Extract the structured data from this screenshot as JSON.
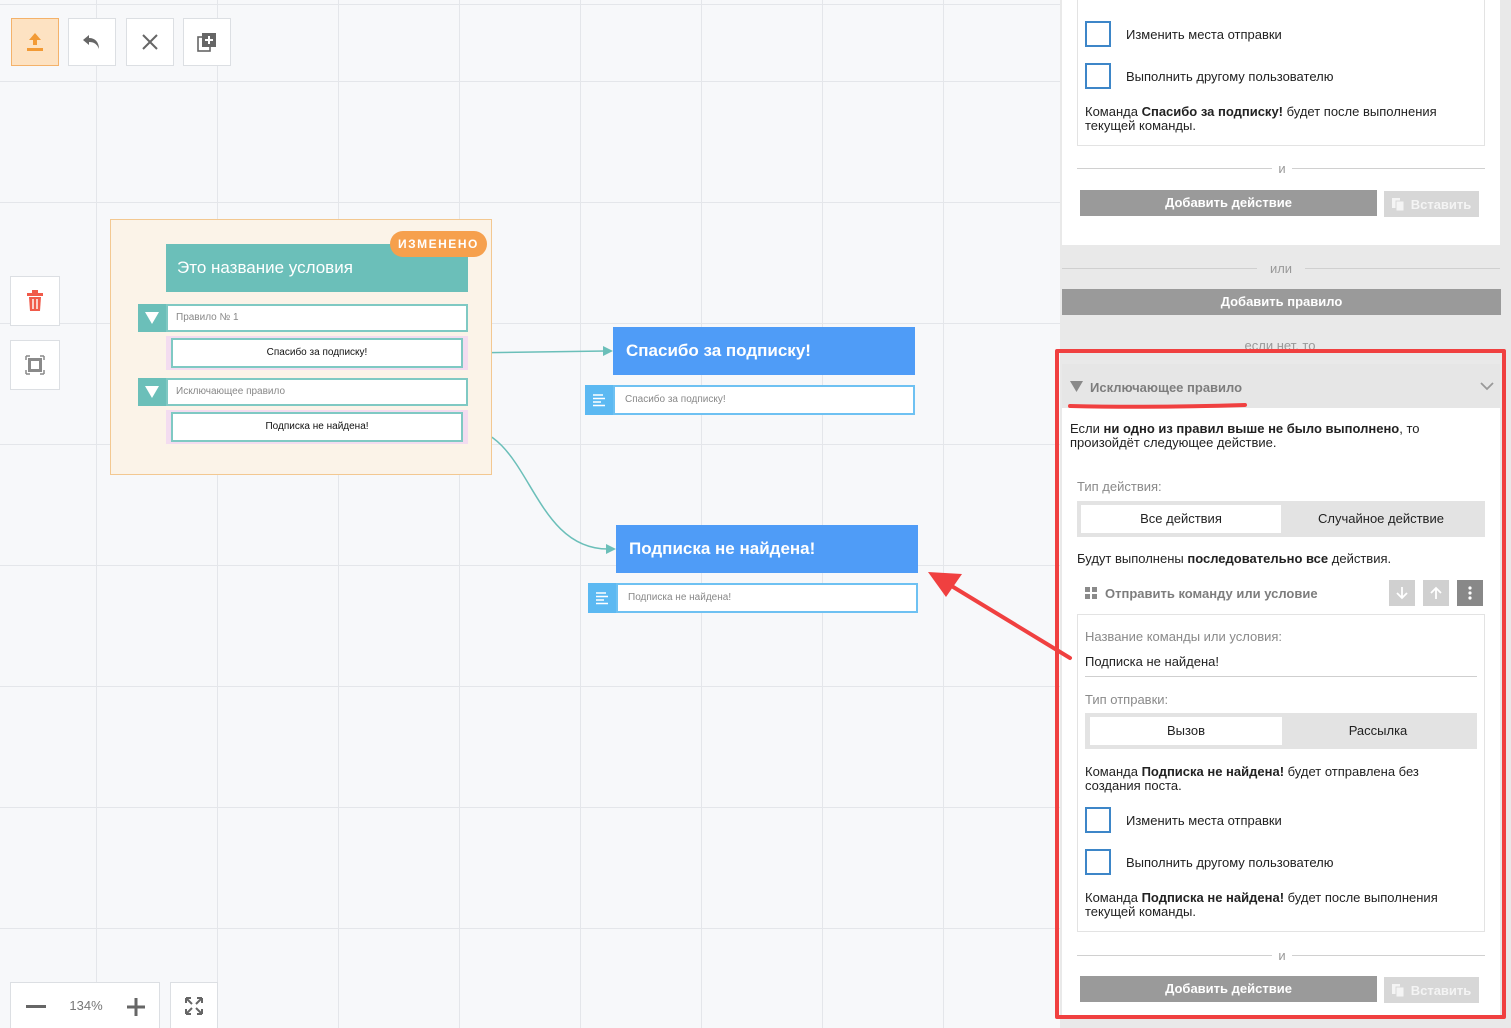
{
  "toolbar": {
    "icons": [
      "upload-icon",
      "undo-icon",
      "close-icon",
      "copy-add-icon"
    ]
  },
  "canvas": {
    "group": {
      "badge": "ИЗМЕНЕНО",
      "title": "Это название условия",
      "rules": [
        {
          "name": "Правило № 1",
          "action": "Спасибо за подписку!"
        },
        {
          "name": "Исключающее правило",
          "action": "Подписка не найдена!"
        }
      ]
    },
    "nodes": [
      {
        "title": "Спасибо за подписку!",
        "body": "Спасибо за подписку!"
      },
      {
        "title": "Подписка не найдена!",
        "body": "Подписка не найдена!"
      }
    ],
    "zoom": {
      "level": "134%"
    }
  },
  "panel": {
    "top_card": {
      "checkbox1": "Изменить места отправки",
      "checkbox2": "Выполнить другому пользователю",
      "note_prefix": "Команда ",
      "note_bold": "Спасибо за подписку!",
      "note_suffix": " будет после выполнения текущей команды.",
      "and": "и",
      "add_action": "Добавить действие",
      "paste": "Вставить"
    },
    "or": "или",
    "add_rule": "Добавить правило",
    "else_label": "если нет, то",
    "exclusive": {
      "title": "Исключающее правило",
      "desc_prefix": "Если ",
      "desc_bold": "ни одно из правил выше не было выполнено",
      "desc_suffix": ", то произойдёт следующее действие.",
      "action_type_label": "Тип действия:",
      "action_type_options": [
        "Все действия",
        "Случайное действие"
      ],
      "action_type_selected": "Все действия",
      "sequence_prefix": "Будут выполнены ",
      "sequence_bold": "последовательно все",
      "sequence_suffix": " действия.",
      "block_title": "Отправить команду или условие",
      "name_label": "Название команды или условия:",
      "name_value": "Подписка не найдена!",
      "send_type_label": "Тип отправки:",
      "send_type_options": [
        "Вызов",
        "Рассылка"
      ],
      "send_type_selected": "Вызов",
      "send_note_prefix": "Команда ",
      "send_note_bold": "Подписка не найдена!",
      "send_note_suffix": " будет отправлена без создания поста.",
      "checkbox1": "Изменить места отправки",
      "checkbox2": "Выполнить другому пользователю",
      "after_prefix": "Команда ",
      "after_bold": "Подписка не найдена!",
      "after_suffix": " будет после выполнения текущей команды.",
      "and": "и",
      "add_action": "Добавить действие",
      "paste": "Вставить"
    }
  },
  "colors": {
    "accent_teal": "#6bbfb9",
    "node_blue": "#4f9cf7",
    "badge_orange": "#f6a04d",
    "annotation_red": "#f04040",
    "delete_red": "#f05a4a"
  }
}
